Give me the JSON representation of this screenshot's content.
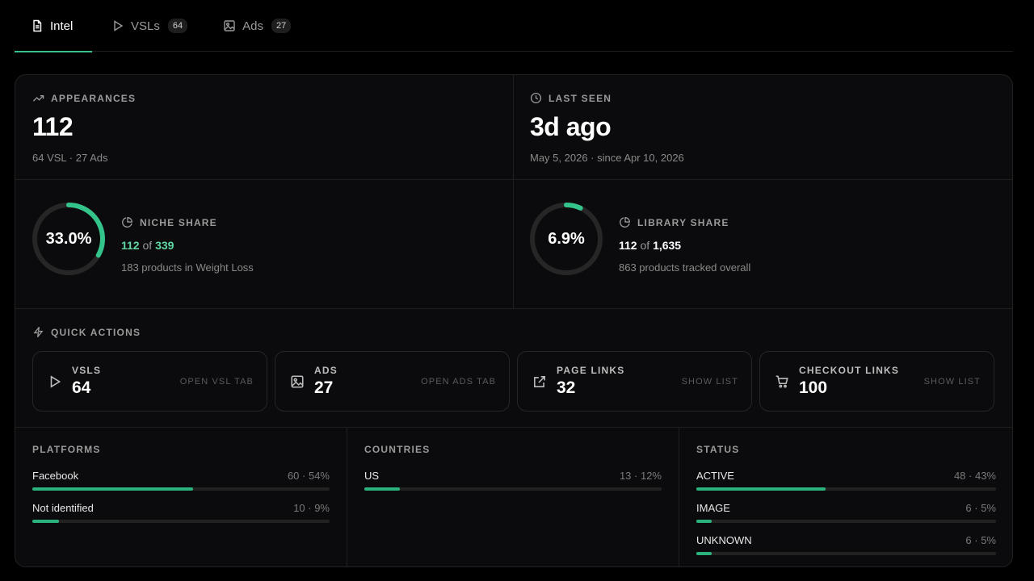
{
  "tabs": [
    {
      "label": "Intel",
      "icon": "document-icon",
      "active": true
    },
    {
      "label": "VSLs",
      "icon": "play-icon",
      "count": "64"
    },
    {
      "label": "Ads",
      "icon": "image-icon",
      "count": "27"
    }
  ],
  "appearances": {
    "label": "APPEARANCES",
    "value": "112",
    "sub": "64 VSL · 27 Ads"
  },
  "last_seen": {
    "label": "LAST SEEN",
    "value": "3d ago",
    "sub": "May 5, 2026 · since Apr 10, 2026"
  },
  "niche_share": {
    "label": "NICHE SHARE",
    "percent_text": "33.0%",
    "fraction": 0.33,
    "count": "112",
    "of": "of",
    "total": "339",
    "desc": "183 products in Weight Loss"
  },
  "library_share": {
    "label": "LIBRARY SHARE",
    "percent_text": "6.9%",
    "fraction": 0.069,
    "count": "112",
    "of": "of",
    "total": "1,635",
    "desc": "863 products tracked overall"
  },
  "quick_actions": {
    "label": "QUICK ACTIONS",
    "cards": [
      {
        "label": "VSLS",
        "value": "64",
        "action": "OPEN VSL TAB",
        "icon": "play-icon"
      },
      {
        "label": "ADS",
        "value": "27",
        "action": "OPEN ADS TAB",
        "icon": "image-icon"
      },
      {
        "label": "PAGE LINKS",
        "value": "32",
        "action": "SHOW LIST",
        "icon": "external-link-icon"
      },
      {
        "label": "CHECKOUT LINKS",
        "value": "100",
        "action": "SHOW LIST",
        "icon": "cart-icon"
      }
    ]
  },
  "platforms": {
    "label": "PLATFORMS",
    "rows": [
      {
        "name": "Facebook",
        "value": "60 · 54%",
        "fraction": 0.54
      },
      {
        "name": "Not identified",
        "value": "10 · 9%",
        "fraction": 0.09
      }
    ]
  },
  "countries": {
    "label": "COUNTRIES",
    "rows": [
      {
        "name": "US",
        "value": "13 · 12%",
        "fraction": 0.12
      }
    ]
  },
  "status": {
    "label": "STATUS",
    "rows": [
      {
        "name": "ACTIVE",
        "value": "48 · 43%",
        "fraction": 0.43
      },
      {
        "name": "IMAGE",
        "value": "6 · 5%",
        "fraction": 0.05
      },
      {
        "name": "UNKNOWN",
        "value": "6 · 5%",
        "fraction": 0.05
      }
    ]
  },
  "colors": {
    "accent": "#34c48b",
    "ring_track": "#262626"
  }
}
